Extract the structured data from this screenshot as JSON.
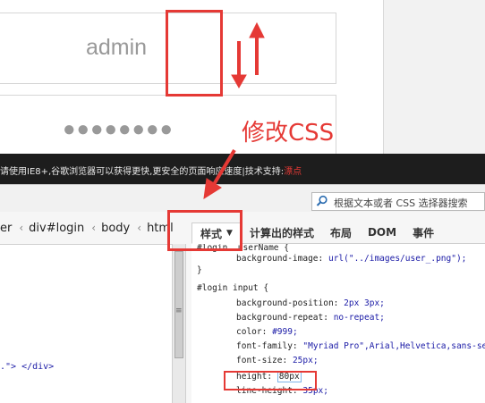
{
  "login_preview": {
    "username_text": "admin",
    "password_mask": "●●●●●●●●"
  },
  "annotation": {
    "label": "修改CSS",
    "color": "#e53935"
  },
  "notice_bar": {
    "text": "请使用IE8+,谷歌浏览器可以获得更快,更安全的页面响应速度|技术支持:",
    "link": "漂点"
  },
  "devtools": {
    "search_placeholder": "根据文本或者 CSS 选择器搜索",
    "breadcrumb": [
      "er",
      "div#login",
      "body",
      "html"
    ],
    "left_code_fragment": ".\"> </div>",
    "tabs": [
      {
        "label": "样式",
        "active": true
      },
      {
        "label": "计算出的样式",
        "active": false
      },
      {
        "label": "布局",
        "active": false
      },
      {
        "label": "DOM",
        "active": false
      },
      {
        "label": "事件",
        "active": false
      }
    ],
    "css_rules": [
      {
        "selector_line": "#login .userName {"
      },
      {
        "decl": {
          "prop": "background-image",
          "val": "url(\"../images/user_.png\");"
        }
      },
      {
        "close": "}"
      },
      {
        "selector_line": "#login input {"
      },
      {
        "decl": {
          "prop": "background-position",
          "val": "2px 3px;"
        }
      },
      {
        "decl": {
          "prop": "background-repeat",
          "val": "no-repeat;"
        }
      },
      {
        "decl": {
          "prop": "color",
          "val": "#999;"
        }
      },
      {
        "decl": {
          "prop": "font-family",
          "val": "\"Myriad Pro\",Arial,Helvetica,sans-seri"
        }
      },
      {
        "decl": {
          "prop": "font-size",
          "val": "25px;"
        }
      },
      {
        "decl": {
          "prop": "height",
          "val": "80px",
          "editing": true
        }
      },
      {
        "decl": {
          "prop": "line-height",
          "val": "35px;"
        }
      }
    ]
  }
}
